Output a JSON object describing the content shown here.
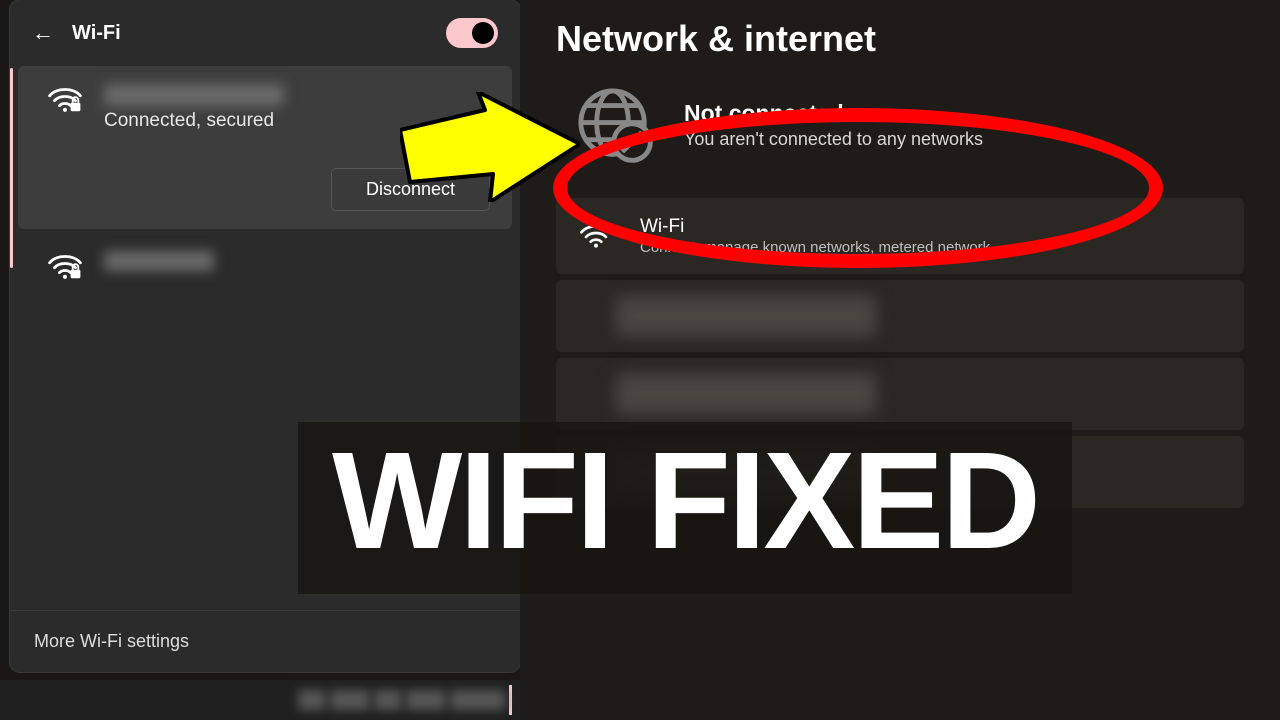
{
  "flyout": {
    "title": "Wi-Fi",
    "active_network_status": "Connected, secured",
    "disconnect_label": "Disconnect",
    "more_settings": "More Wi-Fi settings"
  },
  "settings": {
    "page_title": "Network & internet",
    "status_title": "Not connected",
    "status_subtitle": "You aren't connected to any networks",
    "wifi_card": {
      "title": "Wi-Fi",
      "subtitle": "Connect, manage known networks, metered network"
    }
  },
  "overlay": {
    "headline": "WIFI FIXED"
  }
}
